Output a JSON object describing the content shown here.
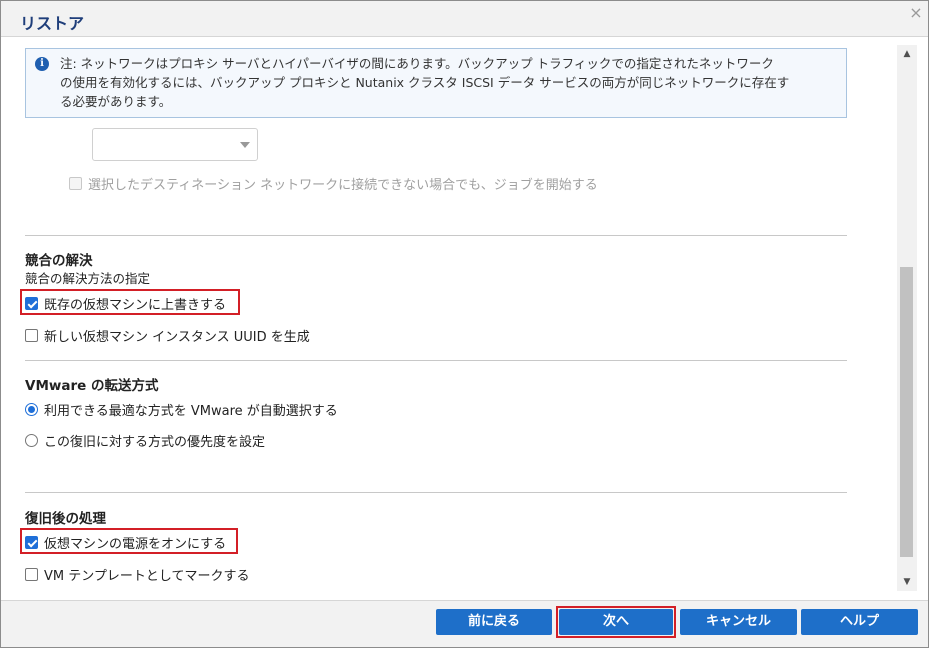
{
  "dialog": {
    "title": "リストア",
    "close_glyph": "×"
  },
  "info": {
    "icon": "info-icon",
    "icon_glyph": "i",
    "line1": "注: ネットワークはプロキシ サーバとハイパーバイザの間にあります。バックアップ トラフィックでの指定されたネットワーク",
    "line2": "の使用を有効化するには、バックアップ プロキシと Nutanix クラスタ ISCSI データ サービスの両方が同じネットワークに存在す",
    "line3": "る必要があります。"
  },
  "network_select": {
    "value": "",
    "disabled": true
  },
  "start_job_checkbox": {
    "label": "選択したデスティネーション ネットワークに接続できない場合でも、ジョブを開始する",
    "checked": false,
    "disabled": true
  },
  "conflict": {
    "heading": "競合の解決",
    "subheading": "競合の解決方法の指定",
    "overwrite_label": "既存の仮想マシンに上書きする",
    "overwrite_checked": true,
    "new_uuid_label": "新しい仮想マシン インスタンス UUID を生成",
    "new_uuid_checked": false
  },
  "transport": {
    "heading": "VMware の転送方式",
    "auto_label": "利用できる最適な方式を VMware が自動選択する",
    "auto_selected": true,
    "priority_label": "この復旧に対する方式の優先度を設定",
    "priority_selected": false
  },
  "post_recovery": {
    "heading": "復旧後の処理",
    "power_on_label": "仮想マシンの電源をオンにする",
    "power_on_checked": true,
    "template_label": "VM テンプレートとしてマークする",
    "template_checked": false
  },
  "footer": {
    "back_label": "前に戻る",
    "next_label": "次へ",
    "cancel_label": "キャンセル",
    "help_label": "ヘルプ"
  },
  "colors": {
    "accent": "#1e6fc9",
    "highlight": "#d31f26",
    "title": "#1f3e7a"
  }
}
